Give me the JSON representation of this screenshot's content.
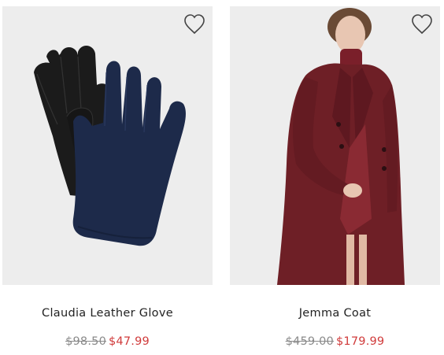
{
  "products": [
    {
      "name": "Claudia Leather Glove",
      "original_price": "$98.50",
      "sale_price": "$47.99",
      "wishlist_icon": "heart-outline-icon",
      "image": "black-and-navy-gloves"
    },
    {
      "name": "Jemma Coat",
      "original_price": "$459.00",
      "sale_price": "$179.99",
      "wishlist_icon": "heart-outline-icon",
      "image": "burgundy-coat-model"
    }
  ],
  "colors": {
    "sale": "#d03b3b",
    "original": "#8a8a8a",
    "image_bg": "#ededed",
    "coat": "#6e1f26",
    "glove_black": "#1b1b1b",
    "glove_navy": "#1d2a4a"
  }
}
